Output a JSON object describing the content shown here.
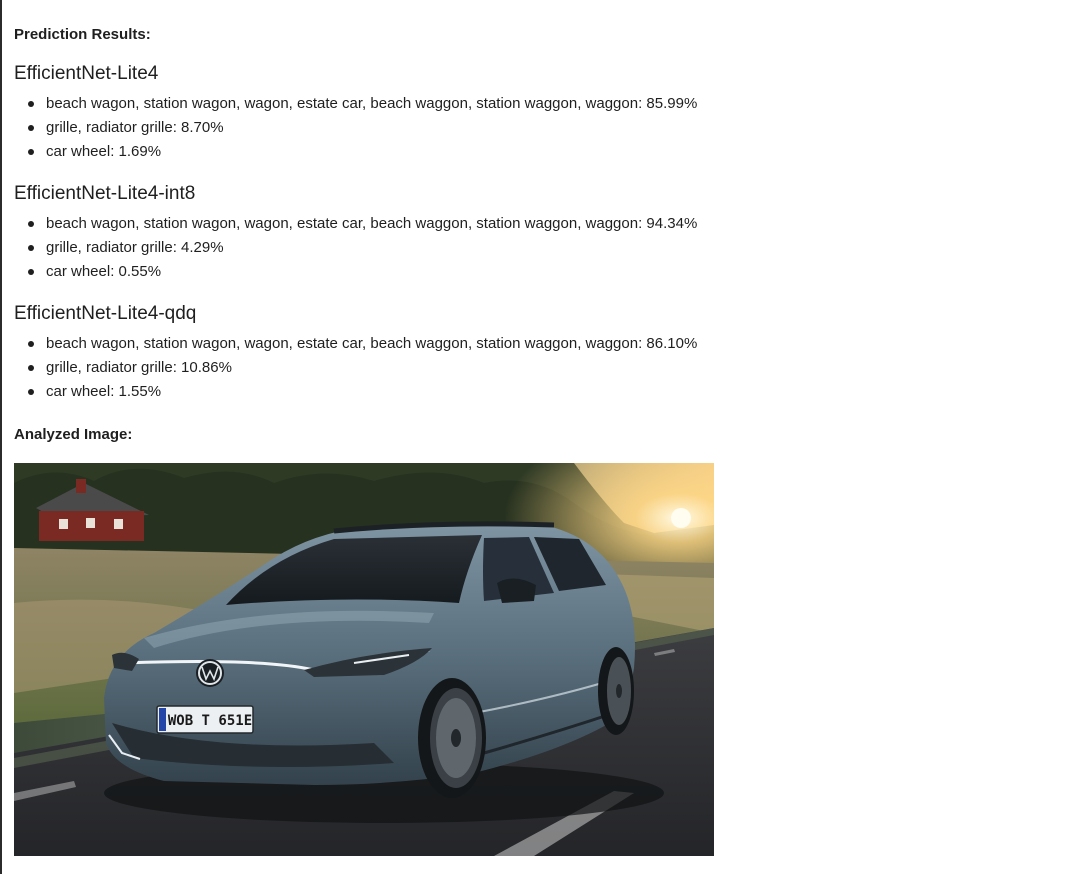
{
  "prediction_heading": "Prediction Results:",
  "models": [
    {
      "name": "EfficientNet-Lite4",
      "predictions": [
        "beach wagon, station wagon, wagon, estate car, beach waggon, station waggon, waggon: 85.99%",
        "grille, radiator grille: 8.70%",
        "car wheel: 1.69%"
      ]
    },
    {
      "name": "EfficientNet-Lite4-int8",
      "predictions": [
        "beach wagon, station wagon, wagon, estate car, beach waggon, station waggon, waggon: 94.34%",
        "grille, radiator grille: 4.29%",
        "car wheel: 0.55%"
      ]
    },
    {
      "name": "EfficientNet-Lite4-qdq",
      "predictions": [
        "beach wagon, station wagon, wagon, estate car, beach waggon, station waggon, waggon: 86.10%",
        "grille, radiator grille: 10.86%",
        "car wheel: 1.55%"
      ]
    }
  ],
  "analyzed_heading": "Analyzed Image:",
  "image": {
    "license_plate": "WOB T 651E"
  }
}
